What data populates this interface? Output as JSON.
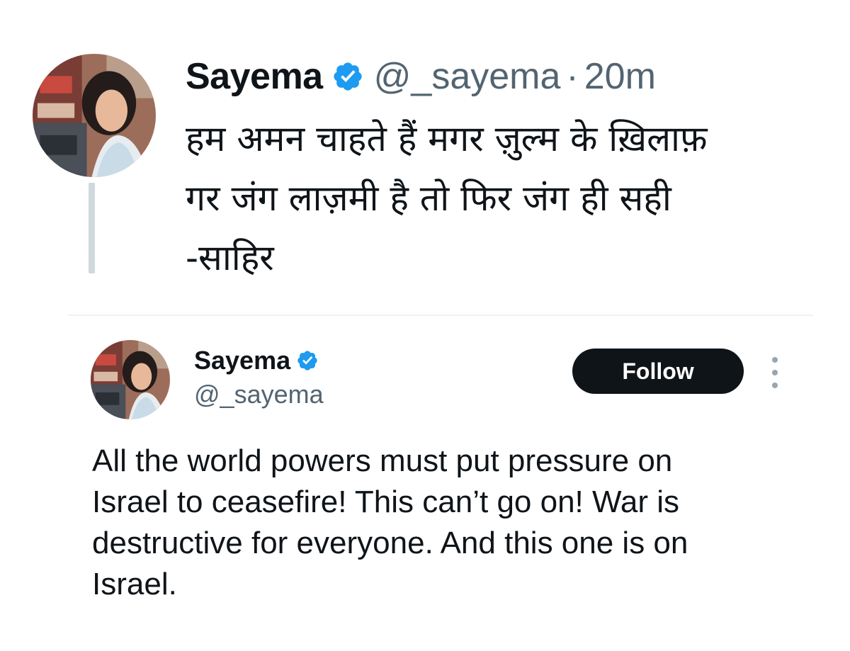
{
  "top_tweet": {
    "author_name": "Sayema",
    "handle": "@_sayema",
    "separator": "·",
    "time": "20m",
    "body_lines": [
      "हम अमन चाहते हैं मगर ज़ुल्म के ख़िलाफ़",
      "गर जंग लाज़मी है तो फिर जंग ही सही",
      "-साहिर"
    ]
  },
  "bottom_tweet": {
    "author_name": "Sayema",
    "handle": "@_sayema",
    "follow_label": "Follow",
    "body_lines": [
      "All the world powers must put pressure on",
      "Israel to ceasefire! This can’t go on! War is",
      "destructive for everyone. And this one is on",
      "Israel."
    ]
  },
  "colors": {
    "verified": "#1d9bf0",
    "text": "#0f1419",
    "muted": "#536471",
    "divider": "#eff3f4",
    "follow_bg": "#0f1419"
  },
  "icons": {
    "verified": "verified-badge-icon",
    "more": "more-options-icon"
  }
}
